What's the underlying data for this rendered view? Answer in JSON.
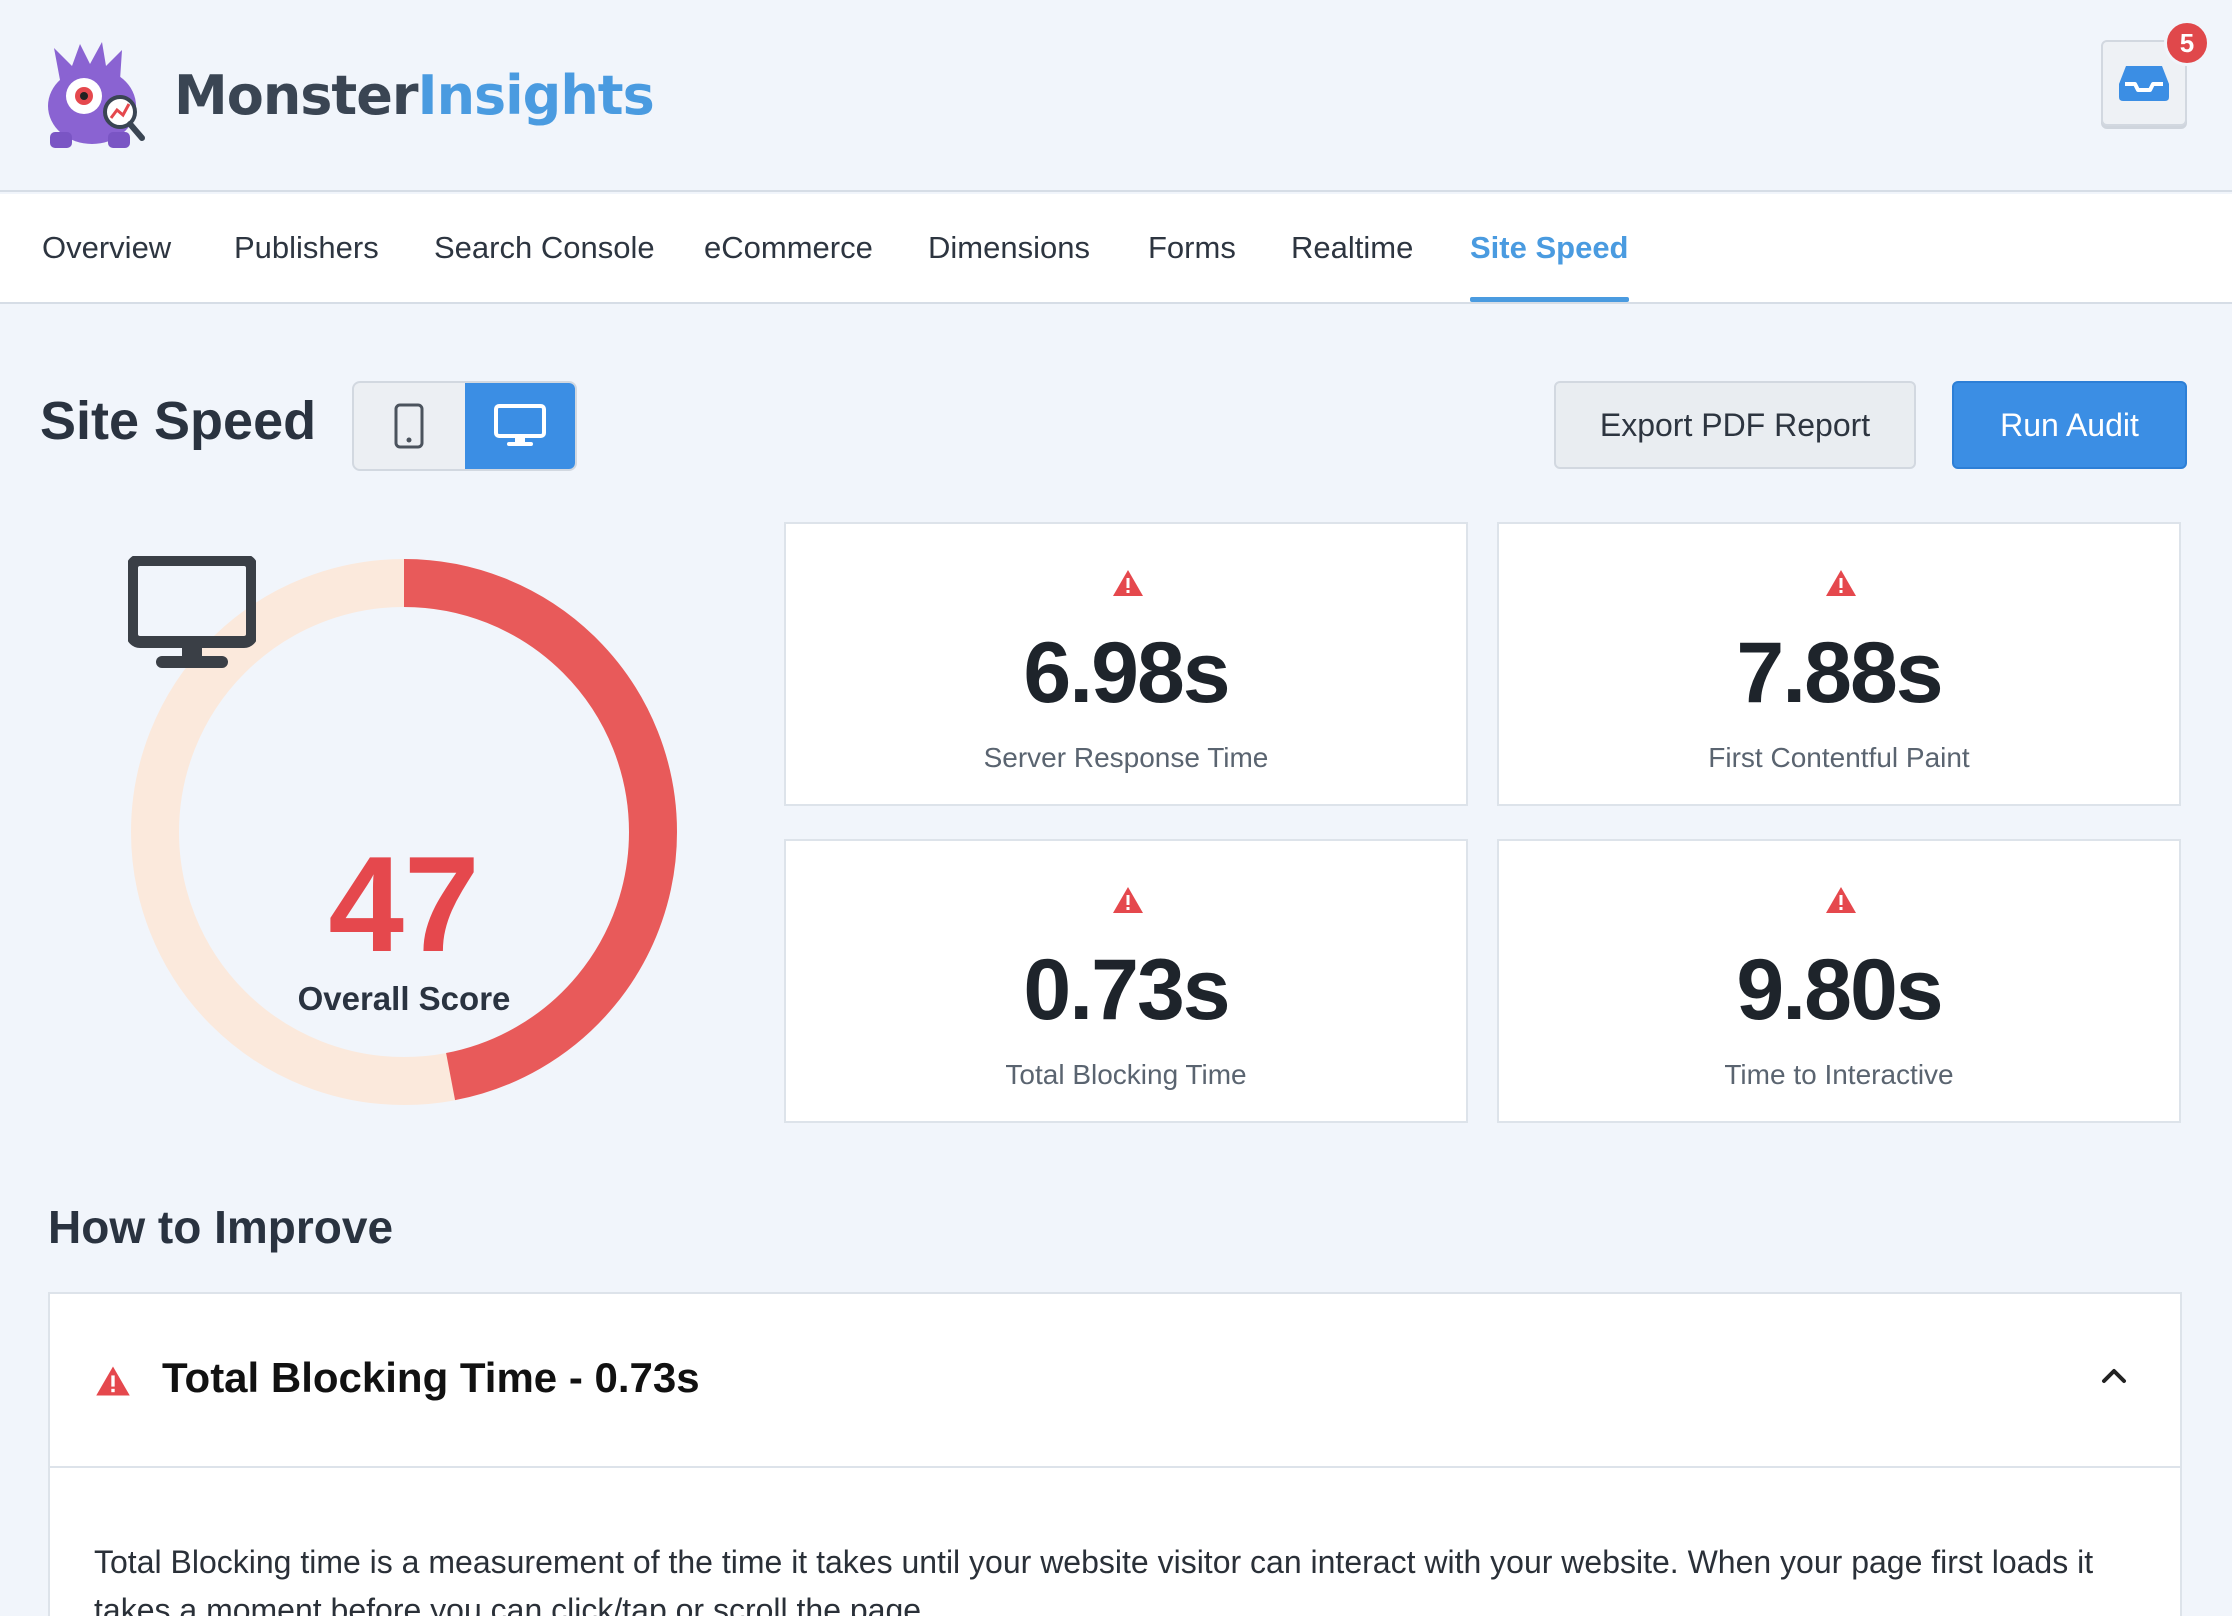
{
  "brand": {
    "name_part1": "Monster",
    "name_part2": "Insights"
  },
  "notifications": {
    "count": "5"
  },
  "nav": {
    "tabs": [
      {
        "label": "Overview"
      },
      {
        "label": "Publishers"
      },
      {
        "label": "Search Console"
      },
      {
        "label": "eCommerce"
      },
      {
        "label": "Dimensions"
      },
      {
        "label": "Forms"
      },
      {
        "label": "Realtime"
      },
      {
        "label": "Site Speed"
      }
    ],
    "active": "Site Speed"
  },
  "page": {
    "title": "Site Speed",
    "device_selected": "desktop",
    "export_label": "Export PDF Report",
    "run_label": "Run Audit"
  },
  "score": {
    "value": "47",
    "label": "Overall Score",
    "fraction": 0.47
  },
  "metrics": [
    {
      "value": "6.98s",
      "label": "Server Response Time"
    },
    {
      "value": "7.88s",
      "label": "First Contentful Paint"
    },
    {
      "value": "0.73s",
      "label": "Total Blocking Time"
    },
    {
      "value": "9.80s",
      "label": "Time to Interactive"
    }
  ],
  "improve": {
    "title": "How to Improve",
    "item_title": "Total Blocking Time - 0.73s",
    "item_body": "Total Blocking time is a measurement of the time it takes until your website visitor can interact with your website. When your page first loads it takes a moment before you can click/tap or scroll the page."
  },
  "colors": {
    "accent": "#3b8ee4",
    "danger": "#e5484d",
    "ring_track": "#fbe9dc"
  }
}
